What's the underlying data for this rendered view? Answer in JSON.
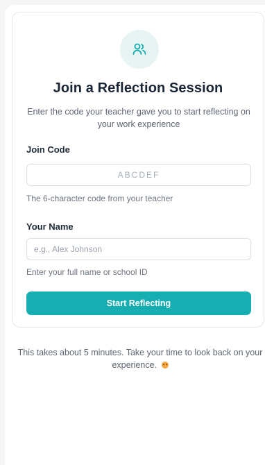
{
  "card": {
    "title": "Join a Reflection Session",
    "subtitle": "Enter the code your teacher gave you to start reflecting on your work experience",
    "icon": "users-icon"
  },
  "join_code": {
    "label": "Join Code",
    "placeholder": "ABCDEF",
    "helper": "The 6-character code from your teacher"
  },
  "name": {
    "label": "Your Name",
    "placeholder": "e.g., Alex Johnson",
    "helper": "Enter your full name or school ID"
  },
  "button": {
    "label": "Start Reflecting"
  },
  "footer": {
    "note": "This takes about 5 minutes. Take your time to look back on your experience."
  },
  "colors": {
    "accent": "#17aeb1",
    "accent_light": "#e6f5f4",
    "title": "#1a2636"
  }
}
